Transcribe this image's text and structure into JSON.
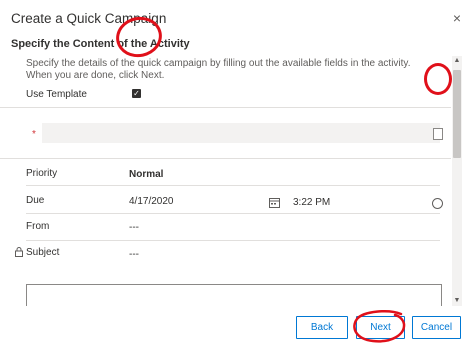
{
  "dialog": {
    "title": "Create a Quick Campaign",
    "close_icon": "×",
    "section_title": "Specify the Content of the Activity",
    "description": "Specify the details of the quick campaign by filling out the available fields in the activity. When you are done, click Next.",
    "use_template": {
      "label": "Use Template",
      "checked": true,
      "check_glyph": "✓"
    },
    "template_field": {
      "required_marker": "*",
      "value": ""
    },
    "fields": [
      {
        "label": "Priority",
        "value": "Normal"
      },
      {
        "label": "Due",
        "date": "4/17/2020",
        "time": "3:22 PM"
      },
      {
        "label": "From",
        "value": "---"
      },
      {
        "label": "Subject",
        "value": "---"
      }
    ],
    "description_text": ""
  },
  "buttons": {
    "back": "Back",
    "next": "Next",
    "cancel": "Cancel"
  },
  "annotations": {
    "circle_color": "#e0101a"
  },
  "colors": {
    "accent": "#0078d4",
    "required": "#d13438"
  },
  "scrollbar": {
    "up_arrow": "▲",
    "down_arrow": "▼"
  }
}
